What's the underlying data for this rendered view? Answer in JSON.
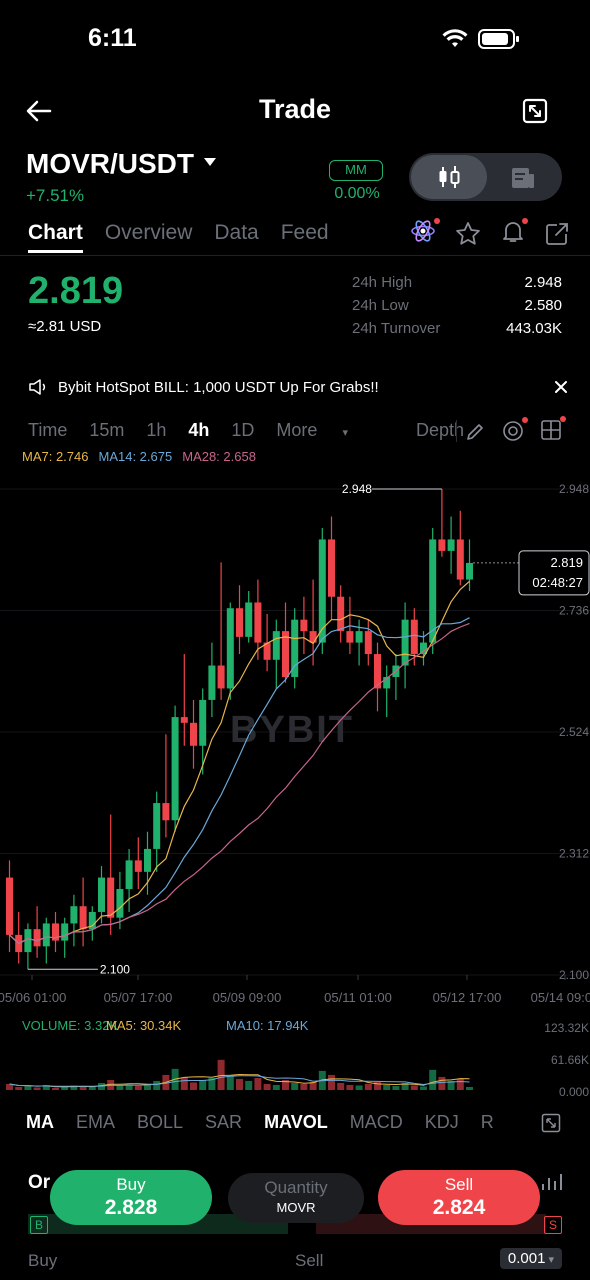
{
  "status": {
    "time": "6:11"
  },
  "header": {
    "title": "Trade"
  },
  "pair": {
    "symbol": "MOVR/USDT",
    "change": "+7.51%",
    "mm_label": "MM",
    "mm_value": "0.00%"
  },
  "tabs": [
    {
      "label": "Chart",
      "active": true
    },
    {
      "label": "Overview"
    },
    {
      "label": "Data"
    },
    {
      "label": "Feed"
    }
  ],
  "price": {
    "last": "2.819",
    "usd": "≈2.81 USD"
  },
  "stats": [
    {
      "label": "24h High",
      "value": "2.948"
    },
    {
      "label": "24h Low",
      "value": "2.580"
    },
    {
      "label": "24h Turnover",
      "value": "443.03K"
    }
  ],
  "banner": {
    "text": "Bybit HotSpot BILL: 1,000 USDT Up For Grabs!!"
  },
  "intervals": [
    "Time",
    "15m",
    "1h",
    "4h",
    "1D",
    "More"
  ],
  "active_interval": "4h",
  "depth_label": "Depth",
  "ma_legend": {
    "ma7": "MA7: 2.746",
    "ma14": "MA14: 2.675",
    "ma28": "MA28: 2.658"
  },
  "colors": {
    "up": "#20b26c",
    "down": "#ef454a",
    "ma7": "#e8b64a",
    "ma14": "#6aa8d8",
    "ma28": "#c8648c"
  },
  "chart_data": {
    "type": "candlestick",
    "y_ticks": [
      "2.948",
      "2.736",
      "2.524",
      "2.312",
      "2.100"
    ],
    "x_ticks": [
      "05/06 01:00",
      "05/07 17:00",
      "05/09 09:00",
      "05/11 01:00",
      "05/12 17:00",
      "05/14 09:00"
    ],
    "high_label": "2.948",
    "low_label": "2.100",
    "current_price": "2.819",
    "countdown": "02:48:27",
    "watermark": "BYBIT",
    "volume_legend": {
      "volume": "VOLUME: 3.32K",
      "ma5": "MA5: 30.34K",
      "ma10": "MA10: 17.94K"
    },
    "volume_ticks": [
      "123.32K",
      "61.66K",
      "0.000"
    ],
    "candles": [
      [
        2.27,
        2.3,
        2.14,
        2.17
      ],
      [
        2.17,
        2.21,
        2.12,
        2.14
      ],
      [
        2.14,
        2.19,
        2.11,
        2.18
      ],
      [
        2.18,
        2.22,
        2.13,
        2.15
      ],
      [
        2.15,
        2.2,
        2.12,
        2.19
      ],
      [
        2.19,
        2.21,
        2.14,
        2.16
      ],
      [
        2.16,
        2.2,
        2.13,
        2.19
      ],
      [
        2.19,
        2.24,
        2.15,
        2.22
      ],
      [
        2.22,
        2.27,
        2.15,
        2.18
      ],
      [
        2.18,
        2.22,
        2.16,
        2.21
      ],
      [
        2.21,
        2.29,
        2.19,
        2.27
      ],
      [
        2.27,
        2.38,
        2.17,
        2.2
      ],
      [
        2.2,
        2.28,
        2.18,
        2.25
      ],
      [
        2.25,
        2.32,
        2.21,
        2.3
      ],
      [
        2.3,
        2.34,
        2.25,
        2.28
      ],
      [
        2.28,
        2.35,
        2.24,
        2.32
      ],
      [
        2.32,
        2.42,
        2.28,
        2.4
      ],
      [
        2.4,
        2.52,
        2.34,
        2.37
      ],
      [
        2.37,
        2.57,
        2.35,
        2.55
      ],
      [
        2.55,
        2.66,
        2.5,
        2.54
      ],
      [
        2.54,
        2.58,
        2.46,
        2.5
      ],
      [
        2.5,
        2.6,
        2.45,
        2.58
      ],
      [
        2.58,
        2.68,
        2.55,
        2.64
      ],
      [
        2.64,
        2.82,
        2.58,
        2.6
      ],
      [
        2.6,
        2.75,
        2.58,
        2.74
      ],
      [
        2.74,
        2.78,
        2.66,
        2.69
      ],
      [
        2.69,
        2.77,
        2.68,
        2.75
      ],
      [
        2.75,
        2.79,
        2.65,
        2.68
      ],
      [
        2.68,
        2.73,
        2.63,
        2.65
      ],
      [
        2.65,
        2.72,
        2.6,
        2.7
      ],
      [
        2.7,
        2.75,
        2.61,
        2.62
      ],
      [
        2.62,
        2.74,
        2.6,
        2.72
      ],
      [
        2.72,
        2.76,
        2.66,
        2.7
      ],
      [
        2.7,
        2.79,
        2.64,
        2.68
      ],
      [
        2.68,
        2.88,
        2.66,
        2.86
      ],
      [
        2.86,
        2.9,
        2.72,
        2.76
      ],
      [
        2.76,
        2.78,
        2.68,
        2.7
      ],
      [
        2.7,
        2.76,
        2.66,
        2.68
      ],
      [
        2.68,
        2.72,
        2.64,
        2.7
      ],
      [
        2.7,
        2.72,
        2.64,
        2.66
      ],
      [
        2.66,
        2.68,
        2.56,
        2.6
      ],
      [
        2.6,
        2.64,
        2.55,
        2.62
      ],
      [
        2.62,
        2.66,
        2.58,
        2.64
      ],
      [
        2.64,
        2.75,
        2.6,
        2.72
      ],
      [
        2.72,
        2.74,
        2.64,
        2.66
      ],
      [
        2.66,
        2.7,
        2.64,
        2.68
      ],
      [
        2.68,
        2.88,
        2.66,
        2.86
      ],
      [
        2.86,
        2.948,
        2.83,
        2.84
      ],
      [
        2.84,
        2.9,
        2.8,
        2.86
      ],
      [
        2.86,
        2.91,
        2.78,
        2.79
      ],
      [
        2.79,
        2.86,
        2.77,
        2.819
      ]
    ],
    "volume": [
      12,
      6,
      8,
      5,
      10,
      4,
      6,
      9,
      7,
      8,
      14,
      20,
      9,
      11,
      8,
      10,
      18,
      30,
      42,
      25,
      15,
      20,
      24,
      60,
      28,
      22,
      18,
      24,
      12,
      10,
      20,
      14,
      12,
      16,
      38,
      30,
      14,
      10,
      9,
      12,
      16,
      10,
      8,
      14,
      9,
      7,
      40,
      26,
      18,
      22,
      6
    ]
  },
  "indicators": [
    "MA",
    "EMA",
    "BOLL",
    "SAR",
    "MAVOL",
    "MACD",
    "KDJ",
    "R"
  ],
  "active_indicators": [
    "MA",
    "MAVOL"
  ],
  "order": {
    "tab": "Or",
    "buy_label": "Buy",
    "buy_price": "2.828",
    "sell_label": "Sell",
    "sell_price": "2.824",
    "qty_label": "Quantity",
    "qty_unit": "MOVR",
    "bottom_buy": "Buy",
    "bottom_sell": "Sell",
    "size": "0.001",
    "buy_badge": "B",
    "sell_badge": "S"
  }
}
